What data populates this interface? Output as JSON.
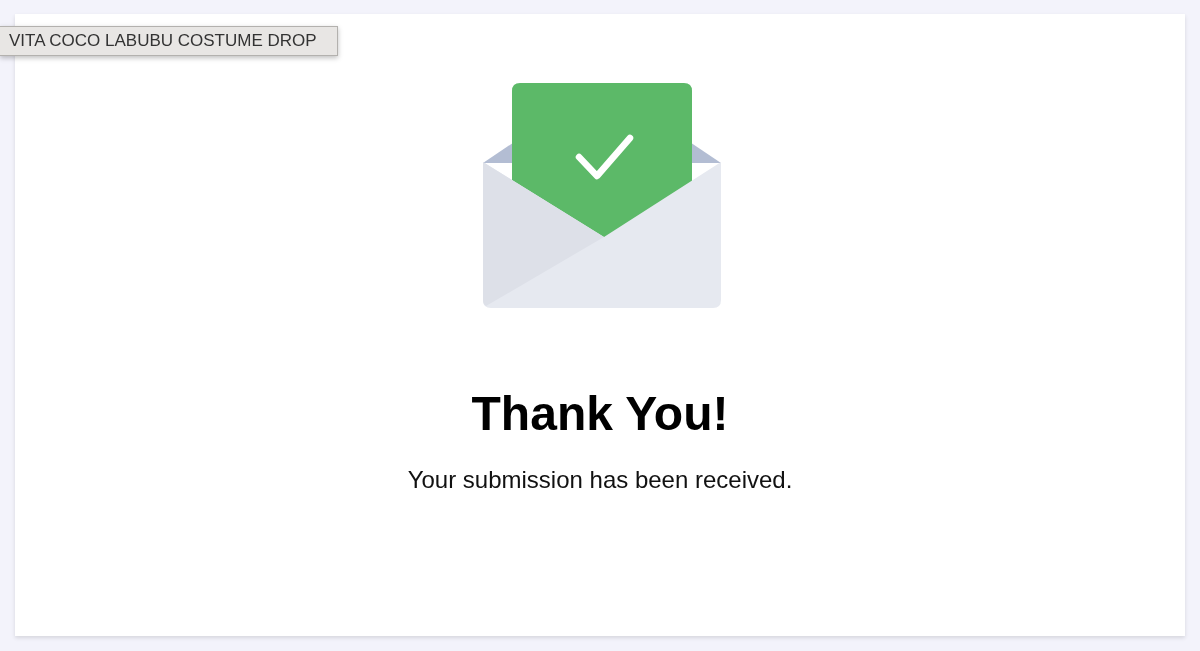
{
  "tooltip": {
    "text": "VITA COCO LABUBU COSTUME DROP"
  },
  "confirmation": {
    "title": "Thank You!",
    "message": "Your submission has been received."
  }
}
